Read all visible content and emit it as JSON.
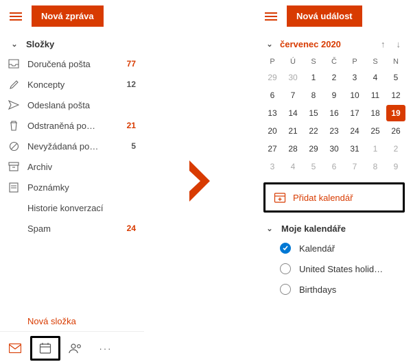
{
  "left": {
    "new_button": "Nová zpráva",
    "folders_header": "Složky",
    "folders": [
      {
        "icon": "inbox",
        "label": "Doručená pošta",
        "count": "77",
        "count_style": "red"
      },
      {
        "icon": "pencil",
        "label": "Koncepty",
        "count": "12",
        "count_style": "gray"
      },
      {
        "icon": "sent",
        "label": "Odeslaná pošta",
        "count": "",
        "count_style": ""
      },
      {
        "icon": "trash",
        "label": "Odstraněná po…",
        "count": "21",
        "count_style": "red"
      },
      {
        "icon": "blocked",
        "label": "Nevyžádaná po…",
        "count": "5",
        "count_style": "gray"
      },
      {
        "icon": "archive",
        "label": "Archiv",
        "count": "",
        "count_style": ""
      },
      {
        "icon": "notes",
        "label": "Poznámky",
        "count": "",
        "count_style": ""
      },
      {
        "icon": "",
        "label": "Historie konverzací",
        "count": "",
        "count_style": ""
      },
      {
        "icon": "",
        "label": "Spam",
        "count": "24",
        "count_style": "red"
      }
    ],
    "new_folder": "Nová složka"
  },
  "right": {
    "new_button": "Nová událost",
    "month_title": "červenec 2020",
    "weekdays": [
      "P",
      "Ú",
      "S",
      "Č",
      "P",
      "S",
      "N"
    ],
    "weeks": [
      {
        "days": [
          "29",
          "30",
          "1",
          "2",
          "3",
          "4",
          "5"
        ],
        "out_mask": [
          1,
          1,
          0,
          0,
          0,
          0,
          0
        ]
      },
      {
        "days": [
          "6",
          "7",
          "8",
          "9",
          "10",
          "11",
          "12"
        ],
        "out_mask": [
          0,
          0,
          0,
          0,
          0,
          0,
          0
        ]
      },
      {
        "days": [
          "13",
          "14",
          "15",
          "16",
          "17",
          "18",
          "19"
        ],
        "out_mask": [
          0,
          0,
          0,
          0,
          0,
          0,
          0
        ],
        "today_index": 6
      },
      {
        "days": [
          "20",
          "21",
          "22",
          "23",
          "24",
          "25",
          "26"
        ],
        "out_mask": [
          0,
          0,
          0,
          0,
          0,
          0,
          0
        ]
      },
      {
        "days": [
          "27",
          "28",
          "29",
          "30",
          "31",
          "1",
          "2"
        ],
        "out_mask": [
          0,
          0,
          0,
          0,
          0,
          1,
          1
        ]
      },
      {
        "days": [
          "3",
          "4",
          "5",
          "6",
          "7",
          "8",
          "9"
        ],
        "out_mask": [
          1,
          1,
          1,
          1,
          1,
          1,
          1
        ]
      }
    ],
    "add_calendar": "Přidat kalendář",
    "my_calendars_header": "Moje kalendáře",
    "calendars": [
      {
        "label": "Kalendář",
        "checked": true
      },
      {
        "label": "United States holid…",
        "checked": false
      },
      {
        "label": "Birthdays",
        "checked": false
      }
    ]
  }
}
